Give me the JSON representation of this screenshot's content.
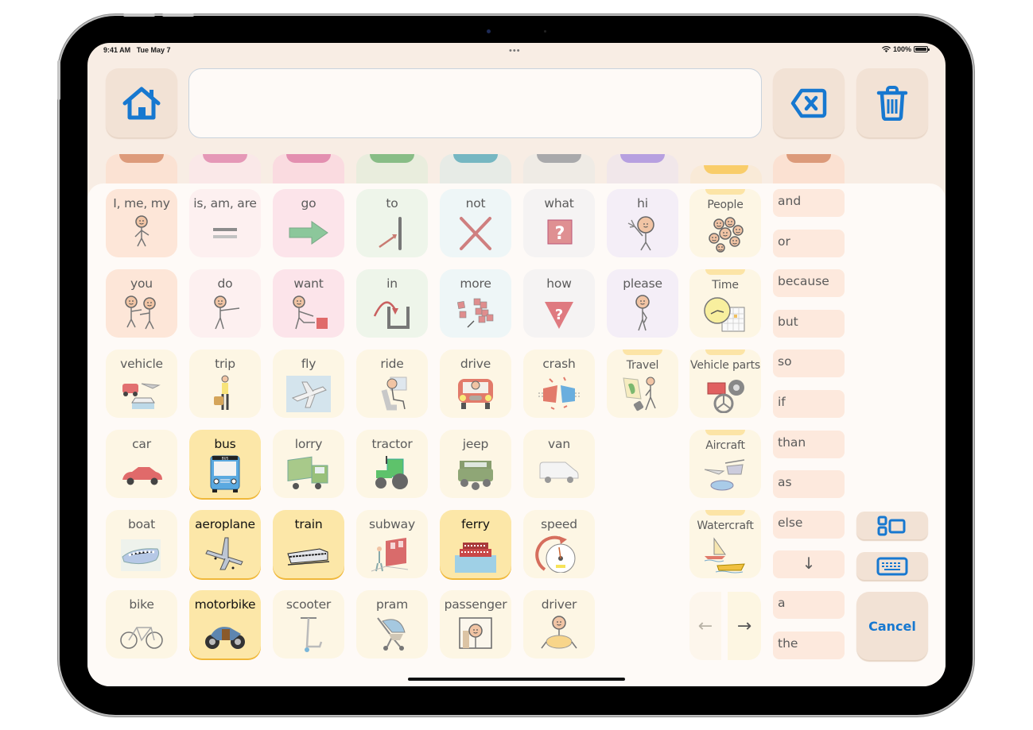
{
  "status_bar": {
    "time": "9:41 AM",
    "date": "Tue May 7",
    "battery": "100%",
    "dots": "•••"
  },
  "toolbar": {
    "home_icon": "house-icon",
    "message": "",
    "backspace_icon": "delete-left-icon",
    "clear_icon": "trash-icon"
  },
  "category_tabs": [
    {
      "color": "#dd9b7b",
      "bg": "#fbe2d3"
    },
    {
      "color": "#e598b7",
      "bg": "#fae8e8"
    },
    {
      "color": "#e38fb0",
      "bg": "#fadbe0"
    },
    {
      "color": "#88bd86",
      "bg": "#e9eddd"
    },
    {
      "color": "#76b7c2",
      "bg": "#e7ebe6"
    },
    {
      "color": "#a9a9ab",
      "bg": "#efebe5"
    },
    {
      "color": "#b7a0e0",
      "bg": "#f1e7ea"
    },
    {
      "color": "#f9cd6a",
      "bg": "#f9ead7"
    },
    {
      "color": "#dc9a7a",
      "bg": "#fbe1d2"
    }
  ],
  "grid": {
    "rows": [
      [
        {
          "label": "I, me, my",
          "icon": "person-pointing-self-icon",
          "bg": "#fde6d8"
        },
        {
          "label": "is, am, are",
          "icon": "equals-icon",
          "bg": "#fdf0f0"
        },
        {
          "label": "go",
          "icon": "arrow-right-icon",
          "bg": "#fce4ea"
        },
        {
          "label": "to",
          "icon": "arrow-to-line-icon",
          "bg": "#eef5ea"
        },
        {
          "label": "not",
          "icon": "cross-icon",
          "bg": "#eef6f7"
        },
        {
          "label": "what",
          "icon": "question-box-icon",
          "bg": "#f5f3f3"
        },
        {
          "label": "hi",
          "icon": "person-waving-icon",
          "bg": "#f4eef7"
        }
      ],
      [
        {
          "label": "you",
          "icon": "two-people-pointing-icon",
          "bg": "#fde6d8"
        },
        {
          "label": "do",
          "icon": "person-reaching-icon",
          "bg": "#fdf0f0"
        },
        {
          "label": "want",
          "icon": "person-want-icon",
          "bg": "#fce4ea"
        },
        {
          "label": "in",
          "icon": "arrow-into-box-icon",
          "bg": "#eef5ea"
        },
        {
          "label": "more",
          "icon": "more-squares-icon",
          "bg": "#eef6f7"
        },
        {
          "label": "how",
          "icon": "question-triangle-icon",
          "bg": "#f5f3f3"
        },
        {
          "label": "please",
          "icon": "person-please-icon",
          "bg": "#f4eef7"
        }
      ],
      [
        {
          "label": "vehicle",
          "icon": "vehicles-icon",
          "bg": "#fdf6e4"
        },
        {
          "label": "trip",
          "icon": "traveller-icon",
          "bg": "#fdf6e4"
        },
        {
          "label": "fly",
          "icon": "plane-sky-icon",
          "bg": "#fdf6e4"
        },
        {
          "label": "ride",
          "icon": "person-seated-icon",
          "bg": "#fdf6e4"
        },
        {
          "label": "drive",
          "icon": "car-driver-icon",
          "bg": "#fdf6e4"
        },
        {
          "label": "crash",
          "icon": "crash-icon",
          "bg": "#fdf6e4"
        },
        {
          "label": "Travel",
          "icon": "map-walker-icon",
          "bg": "#fdf6e4",
          "folder": true
        }
      ],
      [
        {
          "label": "car",
          "icon": "car-icon",
          "bg": "#fdf6e4"
        },
        {
          "label": "bus",
          "icon": "bus-icon",
          "bg": "#fce7a8",
          "highlight": true
        },
        {
          "label": "lorry",
          "icon": "lorry-icon",
          "bg": "#fdf6e4"
        },
        {
          "label": "tractor",
          "icon": "tractor-icon",
          "bg": "#fdf6e4"
        },
        {
          "label": "jeep",
          "icon": "jeep-icon",
          "bg": "#fdf6e4"
        },
        {
          "label": "van",
          "icon": "van-icon",
          "bg": "#fdf6e4"
        }
      ],
      [
        {
          "label": "boat",
          "icon": "boat-icon",
          "bg": "#fdf6e4"
        },
        {
          "label": "aeroplane",
          "icon": "aeroplane-icon",
          "bg": "#fce7a8",
          "highlight": true
        },
        {
          "label": "train",
          "icon": "train-icon",
          "bg": "#fce7a8",
          "highlight": true
        },
        {
          "label": "subway",
          "icon": "subway-icon",
          "bg": "#fdf6e4"
        },
        {
          "label": "ferry",
          "icon": "ferry-icon",
          "bg": "#fce7a8",
          "highlight": true
        },
        {
          "label": "speed",
          "icon": "speedometer-icon",
          "bg": "#fdf6e4"
        }
      ],
      [
        {
          "label": "bike",
          "icon": "bicycle-icon",
          "bg": "#fdf6e4"
        },
        {
          "label": "motorbike",
          "icon": "motorbike-icon",
          "bg": "#fce7a8",
          "highlight": true
        },
        {
          "label": "scooter",
          "icon": "scooter-icon",
          "bg": "#fdf6e4"
        },
        {
          "label": "pram",
          "icon": "pram-icon",
          "bg": "#fdf6e4"
        },
        {
          "label": "passenger",
          "icon": "passenger-icon",
          "bg": "#fdf6e4"
        },
        {
          "label": "driver",
          "icon": "driver-wheel-icon",
          "bg": "#fdf6e4"
        }
      ]
    ]
  },
  "folders": [
    {
      "label": "People",
      "icon": "people-group-icon"
    },
    {
      "label": "Time",
      "icon": "clock-calendar-icon"
    },
    {
      "label": "Vehicle parts",
      "icon": "engine-wheel-icon"
    },
    {
      "label": "Aircraft",
      "icon": "aircraft-icon"
    },
    {
      "label": "Watercraft",
      "icon": "sailboat-speedboat-icon"
    }
  ],
  "words": [
    "and",
    "or",
    "because",
    "but",
    "so",
    "if",
    "than",
    "as",
    "else",
    "↓",
    "a",
    "the"
  ],
  "controls": {
    "layout_icon": "layout-grid-icon",
    "keyboard_icon": "keyboard-icon",
    "cancel_label": "Cancel",
    "prev_arrow": "←",
    "next_arrow": "→",
    "down_arrow": "↓"
  },
  "colors": {
    "accent": "#1778d0",
    "highlight": "#fce7a8",
    "highlight_border": "#f0b83a",
    "word_bg": "#fde9dd",
    "button_bg": "#f2e2d5"
  }
}
